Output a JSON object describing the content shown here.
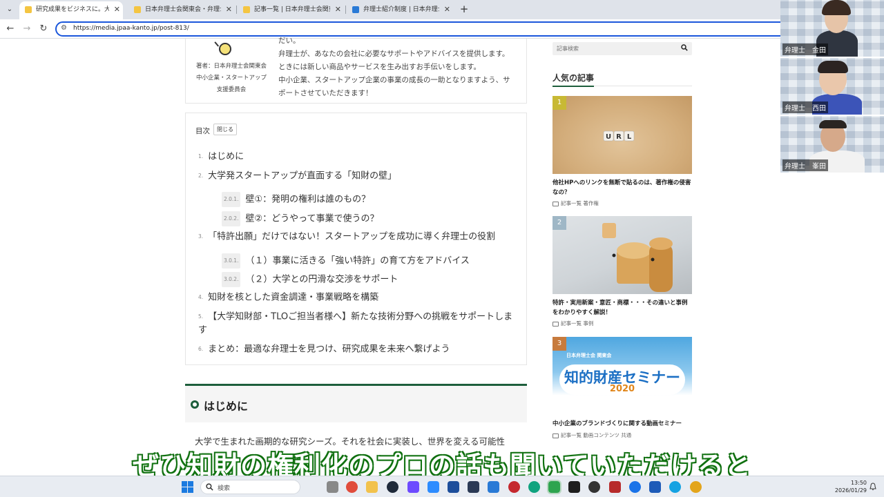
{
  "browser": {
    "tabs": [
      {
        "title": "研究成果をビジネスに。大学発スタ",
        "active": true,
        "favicon_color": "#f4c542"
      },
      {
        "title": "日本弁理士会関東会・弁理士コラ",
        "active": false,
        "favicon_color": "#f4c542"
      },
      {
        "title": "記事一覧 | 日本弁理士会関東会",
        "active": false,
        "favicon_color": "#f4c542"
      },
      {
        "title": "弁理士紹介制度 | 日本弁理士会",
        "active": false,
        "favicon_color": "#2a7ad6"
      }
    ],
    "url": "https://media.jpaa-kanto.jp/post-813/"
  },
  "author": {
    "name": "著者：日本弁理士会関東会 中小企業・スタートアップ支援委員会",
    "description": [
      "だい。",
      "弁理士が、あなたの会社に必要なサポートやアドバイスを提供します。",
      "ときには新しい商品やサービスを生み出すお手伝いをします。",
      "中小企業、スタートアップ企業の事業の成長の一助となりますよう、サ",
      "ポートさせていただきます！"
    ]
  },
  "toc": {
    "title": "目次",
    "close_label": "閉じる",
    "items": [
      {
        "num": "1.",
        "text": "はじめに"
      },
      {
        "num": "2.",
        "text": "大学発スタートアップが直面する「知財の壁」"
      },
      {
        "num": "2.0.1.",
        "text": "壁①：発明の権利は誰のもの？"
      },
      {
        "num": "2.0.2.",
        "text": "壁②：どうやって事業で使うの？"
      },
      {
        "num": "3.",
        "text": "「特許出願」だけではない！スタートアップを成功に導く弁理士の役割"
      },
      {
        "num": "3.0.1.",
        "text": "（１）事業に活きる「強い特許」の育て方をアドバイス"
      },
      {
        "num": "3.0.2.",
        "text": "（２）大学との円滑な交渉をサポート"
      },
      {
        "num": "4.",
        "text": "知財を核とした資金調達・事業戦略を構築"
      },
      {
        "num": "5.",
        "text": "【大学知財部・TLOご担当者様へ】新たな技術分野への挑戦をサポートしま"
      },
      {
        "num": "",
        "text": "す"
      },
      {
        "num": "6.",
        "text": "まとめ：最適な弁理士を見つけ、研究成果を未来へ繋げよう"
      }
    ]
  },
  "section": {
    "heading": "はじめに",
    "body": "大学で生まれた画期的な研究シーズ。それを社会に実装し、世界を変える可能性"
  },
  "sidebar": {
    "search_placeholder": "記事検索",
    "popular_title": "人気の記事",
    "articles": [
      {
        "rank": "1",
        "rank_color": "#c8b934",
        "title": "他社HPへのリンクを無断で貼るのは、著作権の侵害なの？",
        "meta": "記事一覧 著作権",
        "image_word": "URL"
      },
      {
        "rank": "2",
        "rank_color": "#9fb7c6",
        "title": "特許・実用新案・意匠・商標・・・その違いと事例をわかりやすく解説！",
        "meta": "記事一覧 事例"
      },
      {
        "rank": "3",
        "rank_color": "#c77b3d",
        "title": "中小企業のブランドづくりに関する動画セミナー",
        "meta": "記事一覧 動画コンテンツ 共通",
        "banner_org": "日本弁理士会 関東会",
        "banner_title": "知的財産セミナー",
        "banner_year": "2020"
      }
    ]
  },
  "participants": [
    {
      "label": "弁理士　金田"
    },
    {
      "label": "弁理士　西田"
    },
    {
      "label": "弁理士　峯田"
    }
  ],
  "subtitle": "ぜひ知財の権利化のプロの話も聞いていただけると",
  "taskbar": {
    "search_label": "検索",
    "time": "13:50",
    "date": "2026/01/29"
  }
}
